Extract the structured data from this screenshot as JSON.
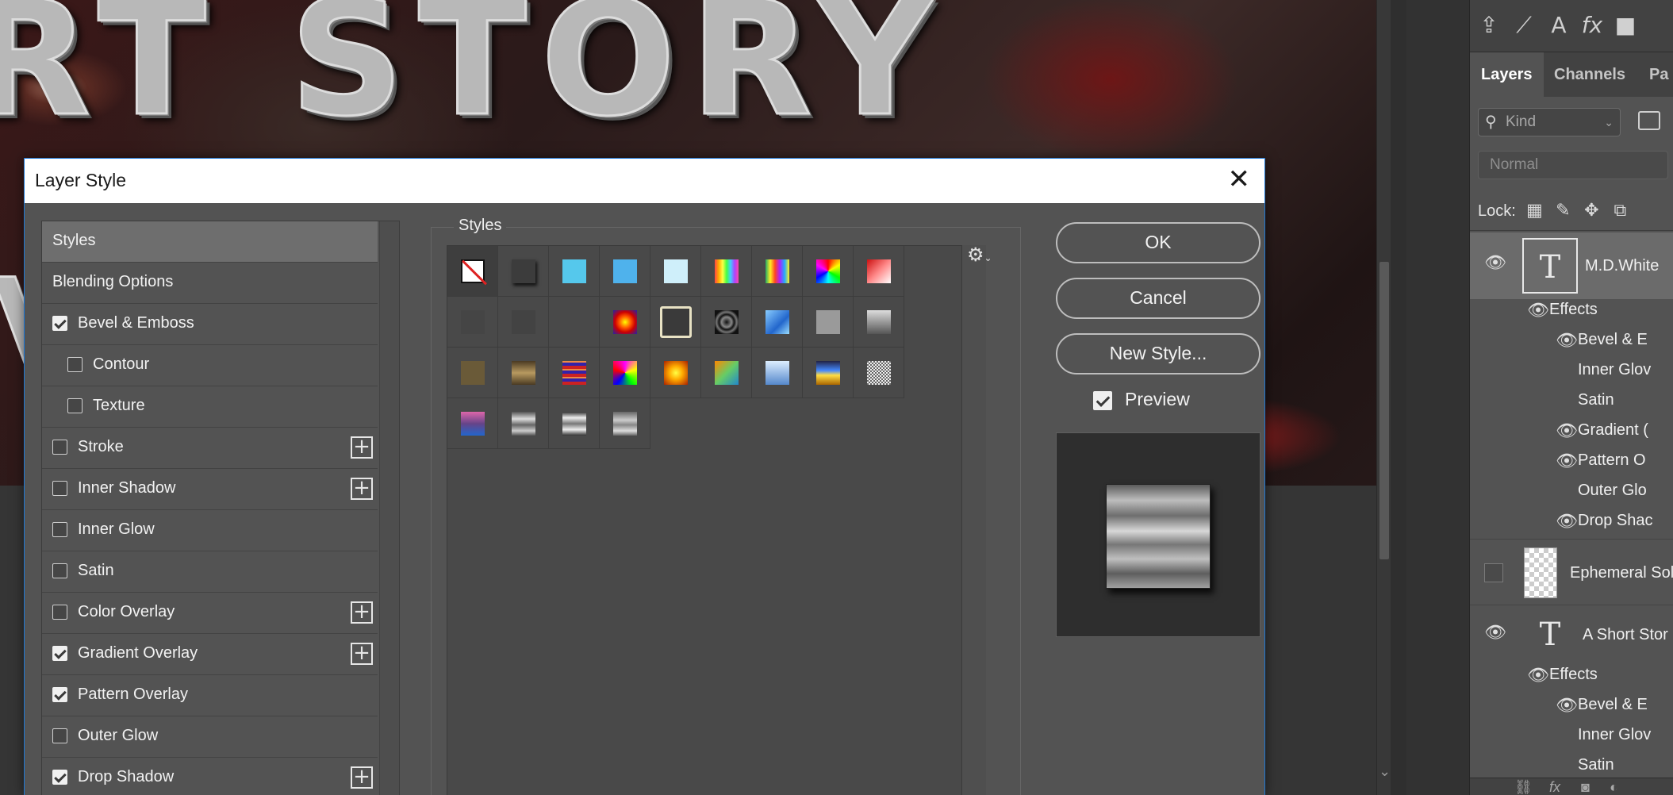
{
  "canvas": {
    "title_art": "RT STORY",
    "v_art": "V"
  },
  "dialog": {
    "title": "Layer Style",
    "close_glyph": "✕",
    "left_list": [
      {
        "label": "Styles",
        "type": "header"
      },
      {
        "label": "Blending Options",
        "type": "plain"
      },
      {
        "label": "Bevel & Emboss",
        "checked": true
      },
      {
        "label": "Contour",
        "checked": false,
        "indent": true
      },
      {
        "label": "Texture",
        "checked": false,
        "indent": true
      },
      {
        "label": "Stroke",
        "checked": false,
        "plus": true
      },
      {
        "label": "Inner Shadow",
        "checked": false,
        "plus": true
      },
      {
        "label": "Inner Glow",
        "checked": false
      },
      {
        "label": "Satin",
        "checked": false
      },
      {
        "label": "Color Overlay",
        "checked": false,
        "plus": true
      },
      {
        "label": "Gradient Overlay",
        "checked": true,
        "plus": true
      },
      {
        "label": "Pattern Overlay",
        "checked": true
      },
      {
        "label": "Outer Glow",
        "checked": false
      },
      {
        "label": "Drop Shadow",
        "checked": true,
        "plus": true
      }
    ],
    "styles_group_label": "Styles",
    "gear_icon": "gear-icon",
    "buttons": {
      "ok": "OK",
      "cancel": "Cancel",
      "new_style": "New Style..."
    },
    "preview": {
      "label": "Preview",
      "checked": true
    },
    "swatches": [
      "none",
      "#3c3c3c",
      "#55c8ec",
      "#4fb2ec",
      "#cfeffa",
      "rainbow-v",
      "rainbow-v2",
      "rainbow-spot",
      "red-white",
      "#454545",
      "#434343",
      "#494949",
      "red-sun",
      "outline",
      "chrome-ring",
      "blue-glass",
      "#9a9a9a",
      "torn",
      "#6a5a38",
      "bronze",
      "stripes-red",
      "colorful",
      "gold",
      "teal-grad",
      "sky",
      "sunset",
      "mono-noise",
      "pink-blue",
      "steel",
      "steel2",
      "steel3"
    ]
  },
  "right_panel": {
    "tabs": [
      "Layers",
      "Channels",
      "Pa"
    ],
    "kind_label": "Kind",
    "blend_mode": "Normal",
    "lock_label": "Lock:",
    "layers": [
      {
        "name": "M.D.White",
        "type": "text",
        "selected": true,
        "visible": true,
        "effects_label": "Effects",
        "effects": [
          {
            "name": "Bevel & E",
            "visible": true
          },
          {
            "name": "Inner Glov",
            "visible": false
          },
          {
            "name": "Satin",
            "visible": false
          },
          {
            "name": "Gradient (",
            "visible": true
          },
          {
            "name": "Pattern O",
            "visible": true
          },
          {
            "name": "Outer Glo",
            "visible": false
          },
          {
            "name": "Drop Shac",
            "visible": true
          }
        ]
      },
      {
        "name": "Ephemeral Sol",
        "type": "image",
        "visible": false
      },
      {
        "name": "A Short Stor",
        "type": "text",
        "visible": true,
        "effects_label": "Effects",
        "effects": [
          {
            "name": "Bevel & E",
            "visible": true
          },
          {
            "name": "Inner Glov",
            "visible": false
          },
          {
            "name": "Satin",
            "visible": false
          }
        ]
      }
    ]
  }
}
